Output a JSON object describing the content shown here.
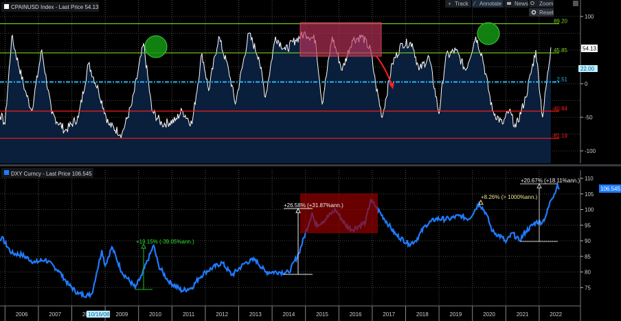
{
  "toolbar": {
    "track": "Track",
    "annotate": "Annotate",
    "news": "News",
    "zoom": "Zoom",
    "reset": "Reset"
  },
  "colors": {
    "dxy": "#1f7bff",
    "cpai": "#ffffff",
    "fill": "#0a1f3b",
    "green": "#7ed321",
    "red": "#ff1a1a",
    "cyan": "#29b6f6"
  },
  "chart_data": [
    {
      "type": "area",
      "title": "CPAINUSD Index - Last Price 54.13",
      "last_price_label": "54.13",
      "marker_label": "22.00",
      "ylim": [
        -110,
        110
      ],
      "yticks": [
        "100",
        "50",
        "0",
        "-50",
        "-100"
      ],
      "ytick_values": [
        100,
        50,
        0,
        -50,
        -100
      ],
      "reference_lines": [
        {
          "value": 89.2,
          "label": "89.20",
          "color": "green"
        },
        {
          "value": 45.85,
          "label": "45.85",
          "color": "green"
        },
        {
          "value": 2.51,
          "label": "2.51",
          "color": "cyan"
        },
        {
          "value": -40.84,
          "label": "-40.84",
          "color": "red"
        },
        {
          "value": -81.19,
          "label": "-81.19",
          "color": "red"
        }
      ],
      "x": [
        2005.3,
        2005.6,
        2006.0,
        2006.2,
        2006.6,
        2006.8,
        2007.1,
        2007.4,
        2007.8,
        2008.2,
        2008.5,
        2008.8,
        2009.1,
        2009.5,
        2009.8,
        2010.15,
        2010.4,
        2010.7,
        2011.1,
        2011.3,
        2011.6,
        2011.9,
        2012.1,
        2012.4,
        2012.7,
        2012.9,
        2013.3,
        2013.6,
        2013.8,
        2014.1,
        2014.4,
        2014.7,
        2015.0,
        2015.3,
        2015.5,
        2015.8,
        2016.1,
        2016.4,
        2016.7,
        2016.95,
        2017.1,
        2017.3,
        2017.6,
        2017.9,
        2018.2,
        2018.4,
        2018.7,
        2019.0,
        2019.2,
        2019.5,
        2019.8,
        2020.1,
        2020.3,
        2020.6,
        2020.9,
        2021.1,
        2021.3,
        2021.6,
        2021.9,
        2022.1,
        2022.35
      ],
      "values": [
        50,
        -20,
        -60,
        70,
        -10,
        -40,
        50,
        -45,
        -70,
        -50,
        30,
        -10,
        -60,
        -75,
        -30,
        60,
        -40,
        -60,
        -55,
        -40,
        -60,
        45,
        -10,
        70,
        20,
        -30,
        75,
        40,
        -20,
        70,
        50,
        65,
        75,
        65,
        -30,
        70,
        20,
        65,
        70,
        50,
        0,
        -50,
        30,
        60,
        60,
        20,
        40,
        -45,
        40,
        50,
        20,
        70,
        40,
        -40,
        -60,
        -40,
        -65,
        -20,
        50,
        -50,
        54.13
      ]
    },
    {
      "type": "line",
      "title": "DXY Curncy - Last Price 106.545",
      "last_price_label": "106.545",
      "ylim": [
        70,
        112
      ],
      "yticks": [
        "110",
        "105",
        "100",
        "95",
        "90",
        "85",
        "80",
        "75"
      ],
      "ytick_values": [
        110,
        105,
        100,
        95,
        90,
        85,
        80,
        75
      ],
      "xticks": [
        "2006",
        "2007",
        "2008",
        "2009",
        "2010",
        "2011",
        "2012",
        "2013",
        "2014",
        "2015",
        "2016",
        "2017",
        "2018",
        "2019",
        "2020",
        "2021",
        "2022"
      ],
      "cursor_date": "10/16/08",
      "annotations": [
        {
          "label": "+19.15% (-39.05%ann.)",
          "color": "green"
        },
        {
          "label": "+26.58% (+31.87%ann.)",
          "color": "white"
        },
        {
          "label": "+8.26% (> 1000%ann.)",
          "color": "yellow"
        },
        {
          "label": "+20.67% (+18.11%ann.)",
          "color": "white"
        }
      ],
      "x": [
        2005.3,
        2005.6,
        2005.9,
        2006.2,
        2006.5,
        2006.9,
        2007.2,
        2007.6,
        2007.9,
        2008.2,
        2008.5,
        2008.6,
        2008.75,
        2008.9,
        2009.0,
        2009.2,
        2009.5,
        2009.9,
        2010.1,
        2010.45,
        2010.6,
        2010.9,
        2011.3,
        2011.6,
        2011.8,
        2012.0,
        2012.5,
        2012.8,
        2013.2,
        2013.5,
        2013.8,
        2014.2,
        2014.5,
        2014.8,
        2015.2,
        2015.3,
        2015.5,
        2015.9,
        2016.2,
        2016.4,
        2016.8,
        2016.95,
        2017.1,
        2017.5,
        2017.7,
        2018.1,
        2018.3,
        2018.6,
        2018.9,
        2019.3,
        2019.6,
        2019.9,
        2020.2,
        2020.4,
        2020.6,
        2020.9,
        2021.0,
        2021.2,
        2021.4,
        2021.6,
        2021.9,
        2022.1,
        2022.2,
        2022.35,
        2022.45,
        2022.55,
        2022.6
      ],
      "values": [
        92,
        89,
        91,
        86,
        85.5,
        83,
        84,
        80.5,
        76,
        73,
        72.5,
        73,
        80,
        87,
        82,
        88,
        80,
        75,
        79,
        88.5,
        82,
        77,
        74,
        75,
        78,
        80,
        83,
        79,
        83,
        84,
        80,
        80,
        79.8,
        86,
        99,
        95,
        96,
        100,
        95,
        93.5,
        96,
        103,
        101,
        95,
        92,
        89,
        90,
        95,
        97,
        97,
        98,
        97,
        102,
        99,
        93,
        91,
        89.5,
        92.5,
        90,
        93,
        96,
        96,
        98,
        103,
        105,
        108,
        106.5
      ]
    }
  ]
}
